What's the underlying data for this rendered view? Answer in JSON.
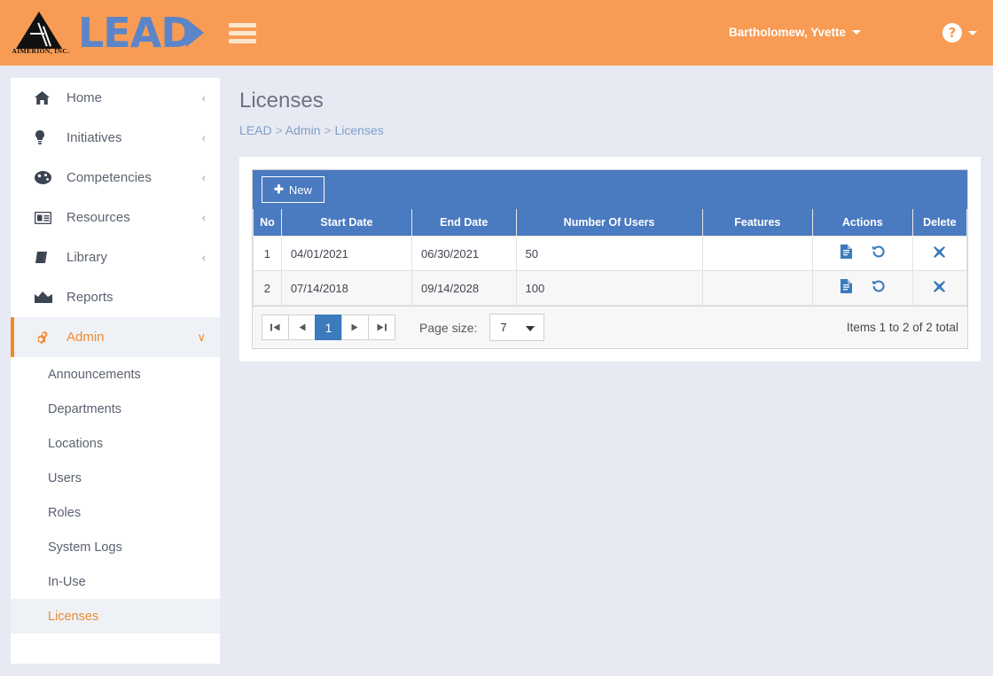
{
  "header": {
    "logo_word": "LEAD",
    "logo_caption": "AIMERION, INC.",
    "menu_icon": "hamburger-icon",
    "user_name": "Bartholomew, Yvette",
    "help_glyph": "?"
  },
  "sidebar": {
    "items": [
      {
        "label": "Home",
        "icon": "home-icon",
        "glyph": "⌂",
        "chevron": "‹",
        "active": false
      },
      {
        "label": "Initiatives",
        "icon": "lightbulb-icon",
        "glyph": "Ὂ1",
        "chevron": "‹",
        "active": false
      },
      {
        "label": "Competencies",
        "icon": "palette-icon",
        "glyph": "◔",
        "chevron": "‹",
        "active": false
      },
      {
        "label": "Resources",
        "icon": "id-card-icon",
        "glyph": "▤",
        "chevron": "‹",
        "active": false
      },
      {
        "label": "Library",
        "icon": "book-icon",
        "glyph": "◧",
        "chevron": "‹",
        "active": false
      },
      {
        "label": "Reports",
        "icon": "chart-area-icon",
        "glyph": "▲",
        "chevron": "",
        "active": false
      },
      {
        "label": "Admin",
        "icon": "gears-icon",
        "glyph": "⚙",
        "chevron": "∨",
        "active": true
      }
    ],
    "subitems": [
      {
        "label": "Announcements",
        "selected": false
      },
      {
        "label": "Departments",
        "selected": false
      },
      {
        "label": "Locations",
        "selected": false
      },
      {
        "label": "Users",
        "selected": false
      },
      {
        "label": "Roles",
        "selected": false
      },
      {
        "label": "System Logs",
        "selected": false
      },
      {
        "label": "In-Use",
        "selected": false
      },
      {
        "label": "Licenses",
        "selected": true
      }
    ]
  },
  "page": {
    "title": "Licenses",
    "breadcrumb": [
      {
        "label": "LEAD",
        "link": true
      },
      {
        "label": ">",
        "link": false
      },
      {
        "label": "Admin",
        "link": true
      },
      {
        "label": ">",
        "link": false
      },
      {
        "label": "Licenses",
        "link": true
      }
    ]
  },
  "grid": {
    "new_button": {
      "plus": "✚",
      "label": "New"
    },
    "columns": [
      "No",
      "Start Date",
      "End Date",
      "Number Of Users",
      "Features",
      "Actions",
      "Delete"
    ],
    "rows": [
      {
        "no": "1",
        "start_date": "04/01/2021",
        "end_date": "06/30/2021",
        "number_of_users": "50",
        "features": "",
        "actions": [
          {
            "icon": "file-document-icon",
            "glyph": "὜E"
          },
          {
            "icon": "history-revert-icon",
            "glyph": "↺"
          }
        ],
        "delete": {
          "icon": "close-x-icon",
          "glyph": "✖"
        }
      },
      {
        "no": "2",
        "start_date": "07/14/2018",
        "end_date": "09/14/2028",
        "number_of_users": "100",
        "features": "",
        "actions": [
          {
            "icon": "file-document-icon",
            "glyph": "὜E"
          },
          {
            "icon": "history-revert-icon",
            "glyph": "↺"
          }
        ],
        "delete": {
          "icon": "close-x-icon",
          "glyph": "✖"
        }
      }
    ]
  },
  "pagination": {
    "first": "⏮",
    "prev": "◀",
    "current_page": "1",
    "next": "▶",
    "last": "⏭",
    "page_size_label": "Page size:",
    "page_size_value": "7",
    "total_text": "Items 1 to 2 of 2 total"
  },
  "colors": {
    "header_orange": "#f89b54",
    "accent_orange": "#ef8a31",
    "grid_blue": "#4a7ac0",
    "page_background": "#e8eaf3",
    "icon_blue": "#3a7abd"
  }
}
